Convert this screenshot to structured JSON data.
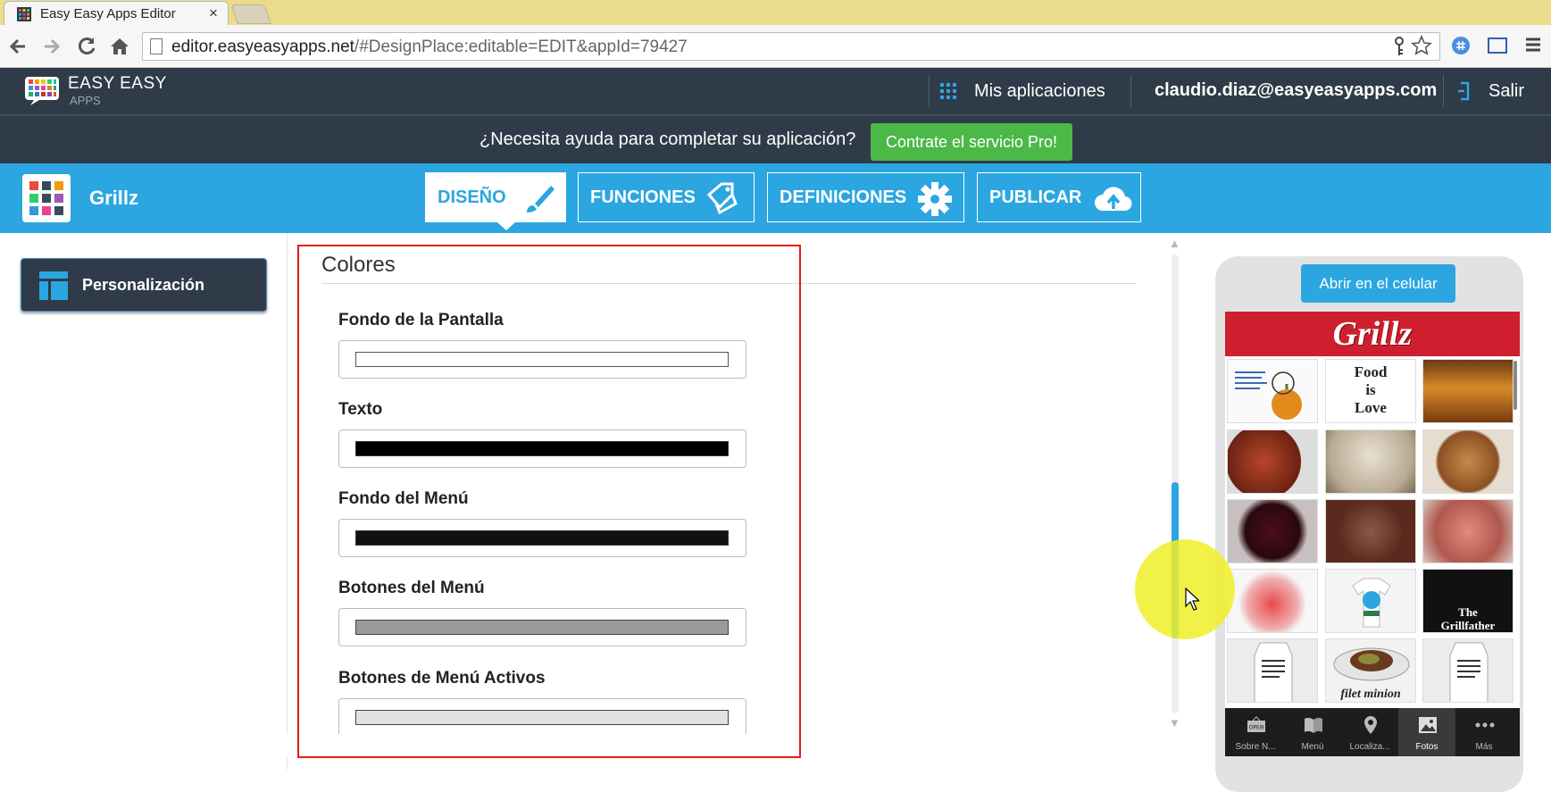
{
  "browser": {
    "tab_title": "Easy Easy Apps Editor",
    "tab_close": "×",
    "url_host": "editor.easyeasyapps.net",
    "url_path": "/#DesignPlace:editable=EDIT&appId=79427"
  },
  "header": {
    "logo_line1": "EASY EASY",
    "logo_line2": "APPS",
    "apps_link": "Mis aplicaciones",
    "user_email": "claudio.diaz@easyeasyapps.com",
    "logout_link": "Salir"
  },
  "banner": {
    "help_text": "¿Necesita ayuda para completar su aplicación?",
    "pro_button": "Contrate el servicio Pro!"
  },
  "appbar": {
    "app_name": "Grillz",
    "tabs": [
      {
        "label": "DISEÑO",
        "icon": "paintbrush-icon",
        "active": true
      },
      {
        "label": "FUNCIONES",
        "icon": "tag-icon",
        "active": false
      },
      {
        "label": "DEFINICIONES",
        "icon": "gear-icon",
        "active": false
      },
      {
        "label": "PUBLICAR",
        "icon": "cloud-upload-icon",
        "active": false
      }
    ]
  },
  "sidebar": {
    "items": [
      {
        "label": "Personalización",
        "icon": "layout-icon",
        "active": true
      }
    ]
  },
  "colors": {
    "section_title": "Colores",
    "fields": [
      {
        "label": "Fondo de la Pantalla",
        "value": "#ffffff"
      },
      {
        "label": "Texto",
        "value": "#000000"
      },
      {
        "label": "Fondo del Menú",
        "value": "#111111"
      },
      {
        "label": "Botones del Menú",
        "value": "#9a9a9a"
      },
      {
        "label": "Botones de Menú Activos",
        "value": "#e2e2e2"
      }
    ]
  },
  "preview": {
    "open_button": "Abrir en el celular",
    "app_title": "Grillz",
    "photo_captions": [
      "Food\nis\nLove",
      "The\nGrillfather",
      "filet minion"
    ],
    "nav": [
      {
        "label": "Sobre N...",
        "icon": "open-sign-icon",
        "active": false
      },
      {
        "label": "Menú",
        "icon": "book-icon",
        "active": false
      },
      {
        "label": "Localiza...",
        "icon": "map-pin-icon",
        "active": false
      },
      {
        "label": "Fotos",
        "icon": "photo-icon",
        "active": true
      },
      {
        "label": "Más",
        "icon": "more-icon",
        "active": false
      }
    ],
    "open_sign": "OPEN"
  },
  "theme": {
    "accent": "#2ba6e0",
    "header_bg": "#2f3b48",
    "pro_green": "#4cb848",
    "highlight_red": "#e51b1b",
    "preview_red": "#cf1f2e"
  }
}
